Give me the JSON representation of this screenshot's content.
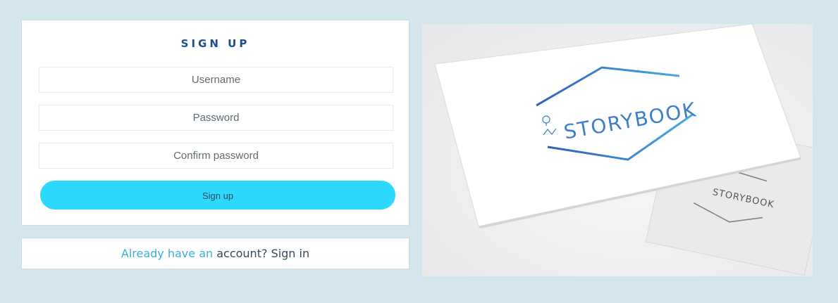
{
  "signup": {
    "title": "SIGN UP",
    "username_placeholder": "Username",
    "password_placeholder": "Password",
    "confirm_placeholder": "Confirm password",
    "submit_label": "Sign up"
  },
  "signin": {
    "prefix": "Already have an",
    "suffix": " account? Sign in"
  },
  "brand": {
    "logo_text": "STORYBOOK",
    "logo_text_back": "STORYBOOK"
  },
  "colors": {
    "background": "#d3e6ed",
    "accent_button": "#2cd8fd",
    "title": "#1d4f8a",
    "link_accent": "#39b0d6",
    "logo_blue": "#3e7fc9"
  }
}
